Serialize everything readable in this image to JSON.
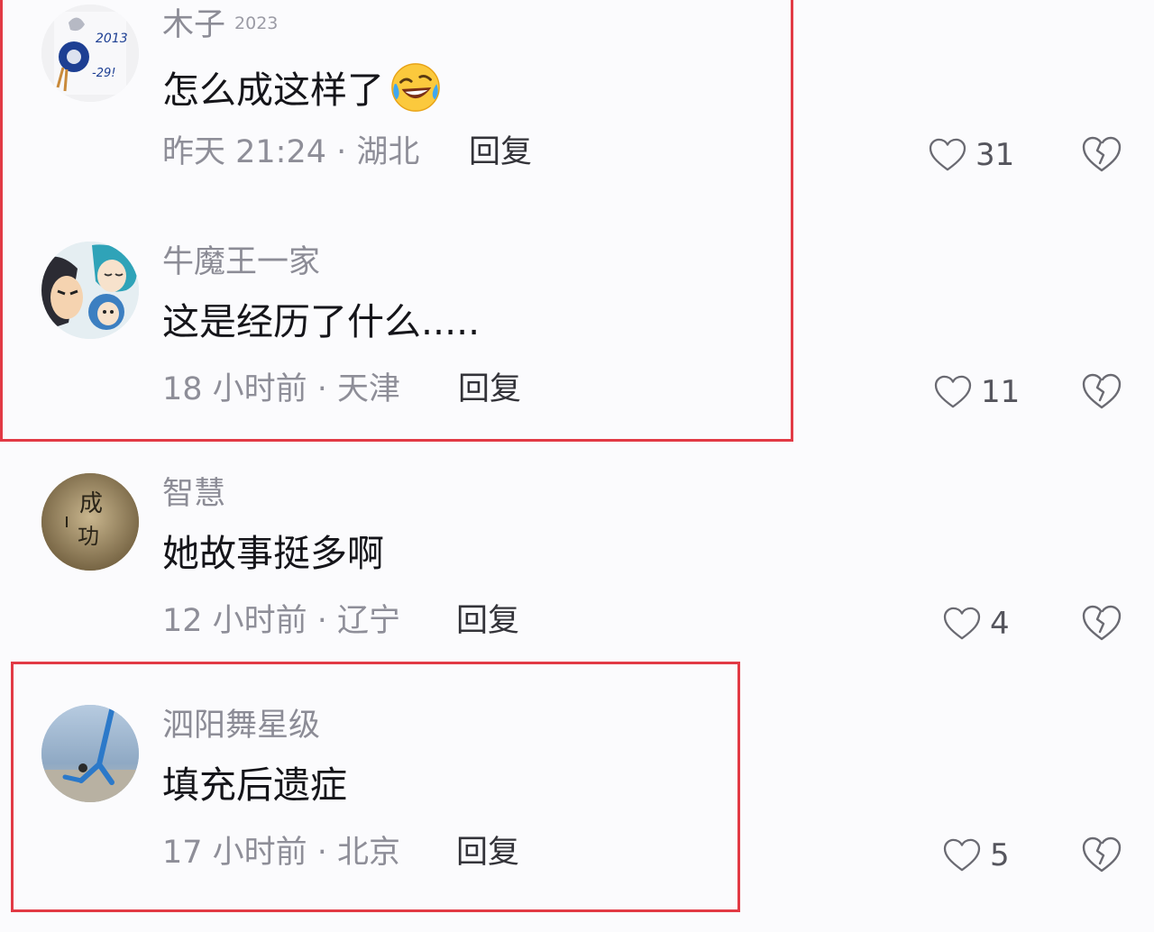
{
  "comments": [
    {
      "username": "木子",
      "badge": "2023",
      "text": "怎么成这样了",
      "emoji": "rofl-emoji",
      "meta": "昨天 21:24 · 湖北",
      "reply_label": "回复",
      "likes": "31"
    },
    {
      "username": "牛魔王一家",
      "badge": "",
      "text": "这是经历了什么.....",
      "meta": "18 小时前 · 天津",
      "reply_label": "回复",
      "likes": "11"
    },
    {
      "username": "智慧",
      "badge": "",
      "text": "她故事挺多啊",
      "meta": "12 小时前 · 辽宁",
      "reply_label": "回复",
      "likes": "4"
    },
    {
      "username": "泗阳舞星级",
      "badge": "",
      "text": "填充后遗症",
      "meta": "17 小时前 · 北京",
      "reply_label": "回复",
      "likes": "5"
    }
  ],
  "avatar_text": {
    "c0": [
      "2013",
      "-29!"
    ],
    "c2": [
      "成",
      "功"
    ]
  },
  "icons": {
    "like": "heart-outline-icon",
    "dislike": "broken-heart-icon"
  },
  "colors": {
    "highlight_border": "#e23a45",
    "background": "#fbfbfd",
    "secondary_text": "#8e8e98"
  }
}
